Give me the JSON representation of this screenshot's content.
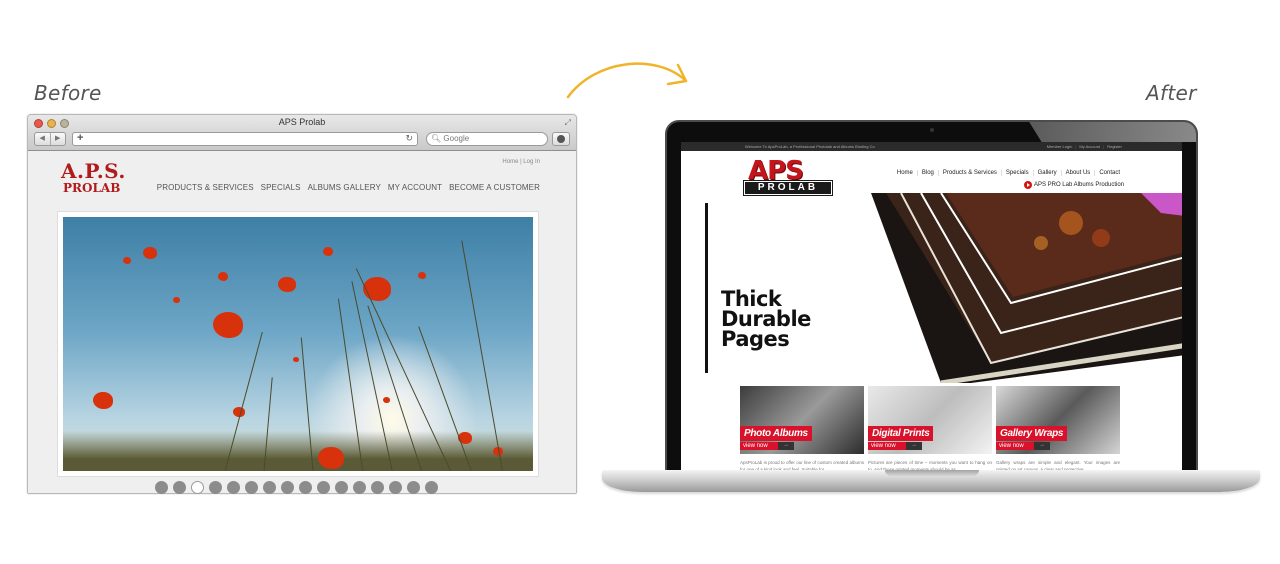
{
  "labels": {
    "before": "Before",
    "after": "After"
  },
  "colors": {
    "arrow": "#f0b429",
    "brand_red": "#d9122b",
    "old_logo_red": "#b01c1c"
  },
  "before": {
    "browser": {
      "window_title": "APS Prolab",
      "url_value": "",
      "search_placeholder": "Google",
      "back_icon": "◀",
      "forward_icon": "▶",
      "new_tab_icon": "+",
      "reload_icon": "↻",
      "fullscreen_icon": "⤢"
    },
    "site": {
      "top_links": "Home | Log In",
      "logo_line1": "A.P.S.",
      "logo_line2": "PROLAB",
      "nav": [
        "PRODUCTS & SERVICES",
        "SPECIALS",
        "ALBUMS GALLERY",
        "MY ACCOUNT",
        "BECOME A CUSTOMER"
      ],
      "slider_dots_count": 16,
      "slider_active_index": 2
    }
  },
  "after": {
    "topbar": {
      "welcome": "Welcome To ApsProLab, a Professional Photolab and Albums Binding Co",
      "links": [
        "Member Login",
        "My Account",
        "Register"
      ]
    },
    "logo": {
      "top": "APS",
      "bottom": "PROLAB"
    },
    "nav": [
      "Home",
      "Blog",
      "Products & Services",
      "Specials",
      "Gallery",
      "About Us",
      "Contact"
    ],
    "sub_link": "APS PRO Lab Albums Production",
    "hero": {
      "lines": [
        "Thick",
        "Durable",
        "Pages"
      ]
    },
    "cards": [
      {
        "title": "Photo Albums",
        "cta": "view now",
        "desc": "ApsProLab is proud to offer our line of custom created albums for one of a kind look and feel. Suitable for"
      },
      {
        "title": "Digital Prints",
        "cta": "view now",
        "desc": "Pictures are pieces of time – moments you want to hang on to. And those printed moments should be as"
      },
      {
        "title": "Gallery Wraps",
        "cta": "view now",
        "desc": "Gallery wraps are simple and elegant. Your images are printed on art canvas. A clear and protective"
      }
    ]
  }
}
